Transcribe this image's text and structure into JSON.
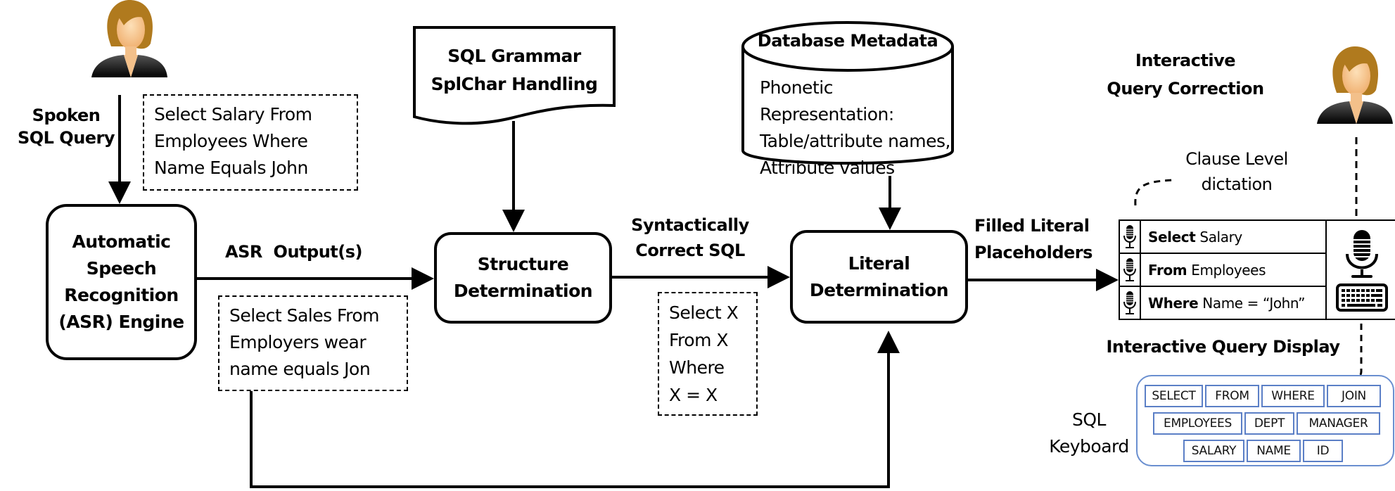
{
  "left_user": {
    "label_lines": [
      "Spoken",
      "SQL Query"
    ]
  },
  "spoken_example": [
    "Select Salary From",
    "Employees Where",
    "Name Equals John"
  ],
  "asr_engine": {
    "lines": [
      "Automatic",
      "Speech",
      "Recognition",
      "(ASR) Engine"
    ]
  },
  "asr_output_label": "ASR  Output(s)",
  "asr_example": [
    "Select Sales From",
    "Employers wear",
    "name equals Jon"
  ],
  "grammar_doc": {
    "lines": [
      "SQL Grammar",
      "SplChar Handling"
    ]
  },
  "structure_box": {
    "lines": [
      "Structure",
      "Determination"
    ]
  },
  "syntactic_label": [
    "Syntactically",
    "Correct SQL"
  ],
  "structure_example": [
    "Select X",
    "From X",
    "Where",
    "X = X"
  ],
  "database": {
    "title": "Database Metadata",
    "lines": [
      "Phonetic Representation:",
      "Table/attribute names,",
      "Attribute values"
    ]
  },
  "literal_box": {
    "lines": [
      "Literal",
      "Determination"
    ]
  },
  "filled_label": [
    "Filled Literal",
    "Placeholders"
  ],
  "correction_title": [
    "Interactive",
    "Query Correction"
  ],
  "clause_dictation": [
    "Clause Level",
    "dictation"
  ],
  "clauses": [
    {
      "keyword": "Select",
      "value": "Salary"
    },
    {
      "keyword": "From",
      "value": "Employees"
    },
    {
      "keyword": "Where",
      "value": "Name = “John”"
    }
  ],
  "display_title": "Interactive Query Display",
  "keyboard_label": [
    "SQL",
    "Keyboard"
  ],
  "keyboard_rows": [
    [
      "SELECT",
      "FROM",
      "WHERE",
      "JOIN"
    ],
    [
      "EMPLOYEES",
      "DEPT",
      "MANAGER"
    ],
    [
      "SALARY",
      "NAME",
      "ID"
    ]
  ],
  "colors": {
    "keyboard_border": "#5b7fc6",
    "hair": "#b07a1e",
    "skin": "#f6c089"
  }
}
